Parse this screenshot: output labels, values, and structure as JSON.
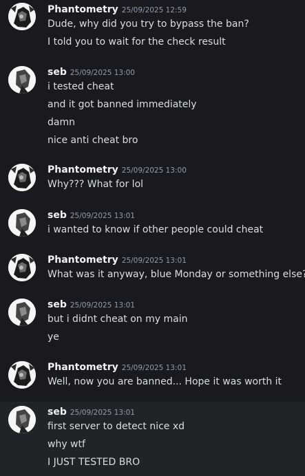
{
  "messages": [
    {
      "author": "Phantometry",
      "time": "25/09/2025 12:59",
      "lines": [
        "Dude, why did you try to bypass the ban?",
        "I told you to wait for the check result"
      ]
    },
    {
      "author": "seb",
      "time": "25/09/2025 13:00",
      "lines": [
        "i tested cheat",
        "and it got banned immediately",
        "damn",
        "nice anti cheat bro"
      ]
    },
    {
      "author": "Phantometry",
      "time": "25/09/2025 13:00",
      "lines": [
        "Why??? What for lol"
      ]
    },
    {
      "author": "seb",
      "time": "25/09/2025 13:01",
      "lines": [
        "i wanted to know if other people could cheat"
      ]
    },
    {
      "author": "Phantometry",
      "time": "25/09/2025 13:01",
      "lines": [
        "What was it anyway, blue Monday or something else?"
      ]
    },
    {
      "author": "seb",
      "time": "25/09/2025 13:01",
      "lines": [
        "but i didnt cheat on my main",
        "ye"
      ]
    },
    {
      "author": "Phantometry",
      "time": "25/09/2025 13:01",
      "lines": [
        "Well, now you are banned... Hope it was worth it"
      ]
    },
    {
      "author": "seb",
      "time": "25/09/2025 13:01",
      "lines": [
        "first server to detect nice xd",
        "why wtf",
        "I JUST TESTED BRO"
      ]
    }
  ],
  "colors": {
    "background": "#1a1a1e",
    "highlight_background": "#222327",
    "username": "#f2f3f5",
    "timestamp": "#949ba4",
    "text": "#dbdee1"
  }
}
